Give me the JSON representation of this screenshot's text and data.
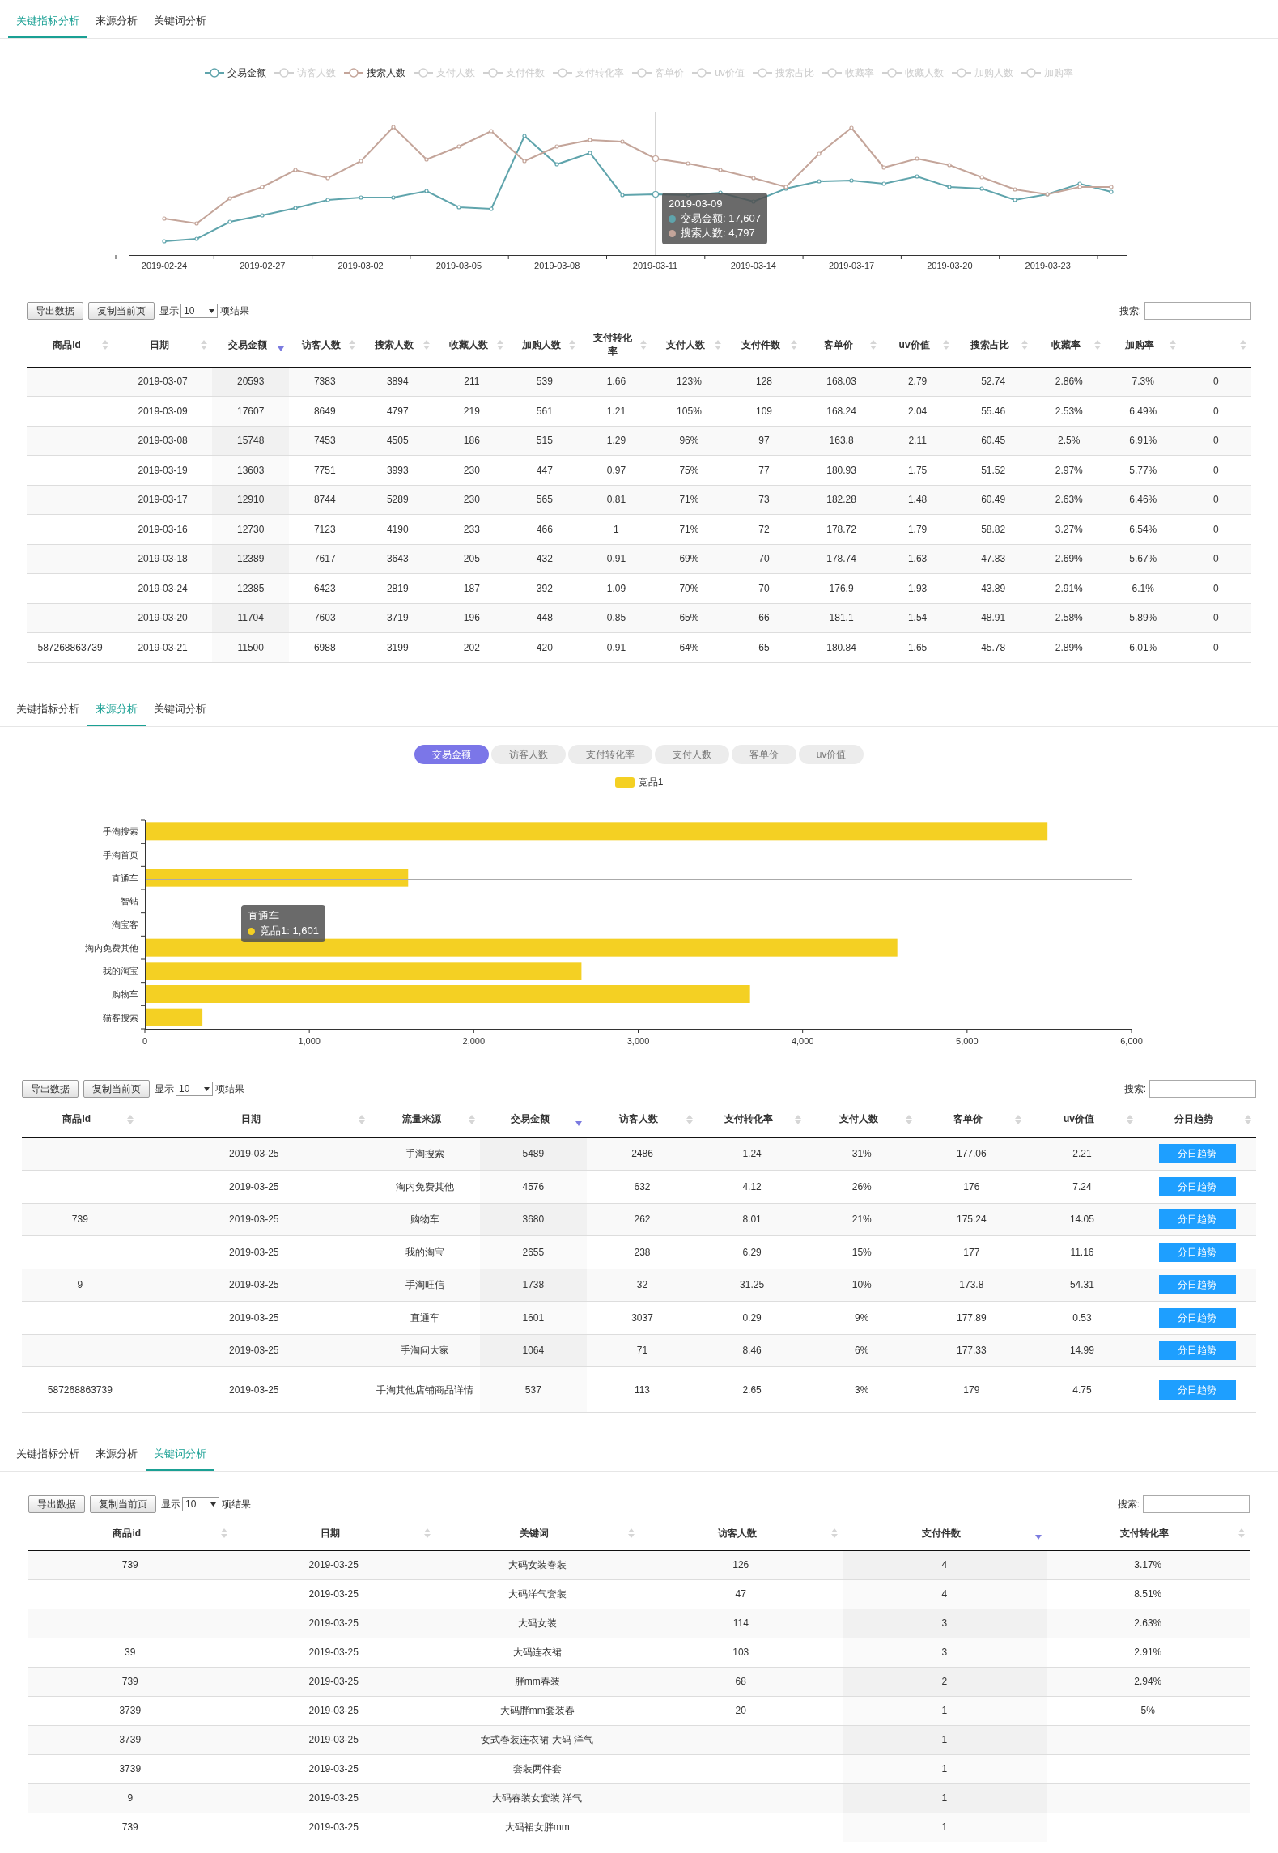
{
  "panels": [
    {
      "kind": "line",
      "tabs": [
        {
          "label": "关键指标分析",
          "selected": true
        },
        {
          "label": "来源分析",
          "selected": false
        },
        {
          "label": "关键词分析",
          "selected": false
        }
      ],
      "legend": [
        {
          "label": "交易金额",
          "selected": true,
          "color": "#5fa4ac"
        },
        {
          "label": "访客人数",
          "selected": false
        },
        {
          "label": "搜索人数",
          "selected": true,
          "color": "#c4a59a"
        },
        {
          "label": "支付人数",
          "selected": false
        },
        {
          "label": "支付件数",
          "selected": false
        },
        {
          "label": "支付转化率",
          "selected": false
        },
        {
          "label": "客单价",
          "selected": false
        },
        {
          "label": "uv价值",
          "selected": false
        },
        {
          "label": "搜索占比",
          "selected": false
        },
        {
          "label": "收藏率",
          "selected": false
        },
        {
          "label": "收藏人数",
          "selected": false
        },
        {
          "label": "加购人数",
          "selected": false
        },
        {
          "label": "加购率",
          "selected": false
        }
      ],
      "x_labels": [
        "2019-02-24",
        "2019-02-27",
        "2019-03-02",
        "2019-03-05",
        "2019-03-08",
        "2019-03-11",
        "2019-03-14",
        "2019-03-17",
        "2019-03-20",
        "2019-03-23"
      ],
      "tooltip": {
        "title": "2019-03-09",
        "items": [
          {
            "text": "交易金额: 17,607",
            "color": "#5fa4ac"
          },
          {
            "text": "搜索人数: 4,797",
            "color": "#c4a59a"
          }
        ]
      },
      "table": {
        "toolbar": {
          "buttons": [
            "导出数据",
            "复制当前页"
          ],
          "show_label": "显示",
          "page_size": "10",
          "suffix": "项结果",
          "search_label": "搜索:"
        },
        "columns": [
          {
            "label": "商品id",
            "sorted": false
          },
          {
            "label": "日期",
            "sorted": false
          },
          {
            "label": "交易金额",
            "sorted": true
          },
          {
            "label": "访客人数",
            "sorted": false
          },
          {
            "label": "搜索人数",
            "sorted": false
          },
          {
            "label": "收藏人数",
            "sorted": false
          },
          {
            "label": "加购人数",
            "sorted": false
          },
          {
            "label": "支付转化率",
            "sorted": false
          },
          {
            "label": "支付人数",
            "sorted": false
          },
          {
            "label": "支付件数",
            "sorted": false
          },
          {
            "label": "客单价",
            "sorted": false
          },
          {
            "label": "uv价值",
            "sorted": false
          },
          {
            "label": "搜索占比",
            "sorted": false
          },
          {
            "label": "收藏率",
            "sorted": false
          },
          {
            "label": "加购率",
            "sorted": false
          },
          {
            "sorted": false
          }
        ],
        "rows": [
          [
            null,
            "2019-03-07",
            "20593",
            "7383",
            "3894",
            "211",
            "539",
            "1.66",
            "123%",
            "128",
            "168.03",
            "2.79",
            "52.74",
            "2.86%",
            "7.3%",
            "0"
          ],
          [
            null,
            "2019-03-09",
            "17607",
            "8649",
            "4797",
            "219",
            "561",
            "1.21",
            "105%",
            "109",
            "168.24",
            "2.04",
            "55.46",
            "2.53%",
            "6.49%",
            "0"
          ],
          [
            null,
            "2019-03-08",
            "15748",
            "7453",
            "4505",
            "186",
            "515",
            "1.29",
            "96%",
            "97",
            "163.8",
            "2.11",
            "60.45",
            "2.5%",
            "6.91%",
            "0"
          ],
          [
            null,
            "2019-03-19",
            "13603",
            "7751",
            "3993",
            "230",
            "447",
            "0.97",
            "75%",
            "77",
            "180.93",
            "1.75",
            "51.52",
            "2.97%",
            "5.77%",
            "0"
          ],
          [
            null,
            "2019-03-17",
            "12910",
            "8744",
            "5289",
            "230",
            "565",
            "0.81",
            "71%",
            "73",
            "182.28",
            "1.48",
            "60.49",
            "2.63%",
            "6.46%",
            "0"
          ],
          [
            null,
            "2019-03-16",
            "12730",
            "7123",
            "4190",
            "233",
            "466",
            "1",
            "71%",
            "72",
            "178.72",
            "1.79",
            "58.82",
            "3.27%",
            "6.54%",
            "0"
          ],
          [
            null,
            "2019-03-18",
            "12389",
            "7617",
            "3643",
            "205",
            "432",
            "0.91",
            "69%",
            "70",
            "178.74",
            "1.63",
            "47.83",
            "2.69%",
            "5.67%",
            "0"
          ],
          [
            null,
            "2019-03-24",
            "12385",
            "6423",
            "2819",
            "187",
            "392",
            "1.09",
            "70%",
            "70",
            "176.9",
            "1.93",
            "43.89",
            "2.91%",
            "6.1%",
            "0"
          ],
          [
            null,
            "2019-03-20",
            "11704",
            "7603",
            "3719",
            "196",
            "448",
            "0.85",
            "65%",
            "66",
            "181.1",
            "1.54",
            "48.91",
            "2.58%",
            "5.89%",
            "0"
          ],
          [
            "587268863739",
            "2019-03-21",
            "11500",
            "6988",
            "3199",
            "202",
            "420",
            "0.91",
            "64%",
            "65",
            "180.84",
            "1.65",
            "45.78",
            "2.89%",
            "6.01%",
            "0"
          ]
        ]
      }
    },
    {
      "kind": "bar",
      "tabs": [
        {
          "label": "关键指标分析",
          "selected": false
        },
        {
          "label": "来源分析",
          "selected": true
        },
        {
          "label": "关键词分析",
          "selected": false
        }
      ],
      "metric_buttons": [
        {
          "label": "交易金额",
          "selected": true
        },
        {
          "label": "访客人数",
          "selected": false
        },
        {
          "label": "支付转化率",
          "selected": false
        },
        {
          "label": "支付人数",
          "selected": false
        },
        {
          "label": "客单价",
          "selected": false
        },
        {
          "label": "uv价值",
          "selected": false
        }
      ],
      "chart_data": {
        "type": "bar",
        "orientation": "horizontal",
        "categories": [
          "手淘搜索",
          "手淘首页",
          "直通车",
          "智钻",
          "淘宝客",
          "淘内免费其他",
          "我的淘宝",
          "购物车",
          "猫客搜索"
        ],
        "series": [
          {
            "name": "竞品1",
            "color": "#f4d023",
            "values": [
              5489,
              null,
              1601,
              null,
              null,
              4576,
              2655,
              3680,
              350
            ]
          }
        ],
        "xlim": [
          0,
          6000
        ],
        "xticks": [
          {
            "value": 0,
            "label": "0"
          },
          {
            "value": 1000,
            "label": "1,000"
          },
          {
            "value": 2000,
            "label": "2,000"
          },
          {
            "value": 3000,
            "label": "3,000"
          },
          {
            "value": 4000,
            "label": "4,000"
          },
          {
            "value": 5000,
            "label": "5,000"
          },
          {
            "value": 6000,
            "label": "6,000"
          }
        ]
      },
      "tooltip": {
        "title": "直通车",
        "items": [
          {
            "text": "竞品1: 1,601",
            "color": "#f4d023"
          }
        ]
      },
      "table": {
        "toolbar": {
          "buttons": [
            "导出数据",
            "复制当前页"
          ],
          "show_label": "显示",
          "page_size": "10",
          "suffix": "项结果",
          "search_label": "搜索:"
        },
        "columns": [
          {
            "label": "商品id",
            "sorted": false
          },
          {
            "label": "日期",
            "sorted": false
          },
          {
            "label": "流量来源",
            "sorted": false
          },
          {
            "label": "交易金额",
            "sorted": true
          },
          {
            "label": "访客人数",
            "sorted": false
          },
          {
            "label": "支付转化率",
            "sorted": false
          },
          {
            "label": "支付人数",
            "sorted": false
          },
          {
            "label": "客单价",
            "sorted": false
          },
          {
            "label": "uv价值",
            "sorted": false
          },
          {
            "label": "分日趋势",
            "sorted": false,
            "kind": "button"
          }
        ],
        "rows": [
          [
            null,
            "2019-03-25",
            "手淘搜索",
            "5489",
            "2486",
            "1.24",
            "31%",
            "177.06",
            "2.21",
            "分日趋势"
          ],
          [
            null,
            "2019-03-25",
            "淘内免费其他",
            "4576",
            "632",
            "4.12",
            "26%",
            "176",
            "7.24",
            "分日趋势"
          ],
          [
            "739",
            "2019-03-25",
            "购物车",
            "3680",
            "262",
            "8.01",
            "21%",
            "175.24",
            "14.05",
            "分日趋势"
          ],
          [
            null,
            "2019-03-25",
            "我的淘宝",
            "2655",
            "238",
            "6.29",
            "15%",
            "177",
            "11.16",
            "分日趋势"
          ],
          [
            "9",
            "2019-03-25",
            "手淘旺信",
            "1738",
            "32",
            "31.25",
            "10%",
            "173.8",
            "54.31",
            "分日趋势"
          ],
          [
            null,
            "2019-03-25",
            "直通车",
            "1601",
            "3037",
            "0.29",
            "9%",
            "177.89",
            "0.53",
            "分日趋势"
          ],
          [
            null,
            "2019-03-25",
            "手淘问大家",
            "1064",
            "71",
            "8.46",
            "6%",
            "177.33",
            "14.99",
            "分日趋势"
          ],
          [
            "587268863739",
            "2019-03-25",
            "手淘其他店铺商品详情",
            "537",
            "113",
            "2.65",
            "3%",
            "179",
            "4.75",
            "分日趋势"
          ]
        ]
      }
    },
    {
      "kind": "plain",
      "tabs": [
        {
          "label": "关键指标分析",
          "selected": false
        },
        {
          "label": "来源分析",
          "selected": false
        },
        {
          "label": "关键词分析",
          "selected": true
        }
      ],
      "table": {
        "toolbar": {
          "buttons": [
            "导出数据",
            "复制当前页"
          ],
          "show_label": "显示",
          "page_size": "10",
          "suffix": "项结果",
          "search_label": "搜索:"
        },
        "columns": [
          {
            "label": "商品id",
            "sorted": false
          },
          {
            "label": "日期",
            "sorted": false
          },
          {
            "label": "关键词",
            "sorted": false
          },
          {
            "label": "访客人数",
            "sorted": false
          },
          {
            "label": "支付件数",
            "sorted": true
          },
          {
            "label": "支付转化率",
            "sorted": false
          }
        ],
        "rows": [
          [
            "739",
            "2019-03-25",
            "大码女装春装",
            "126",
            "4",
            "3.17%"
          ],
          [
            null,
            "2019-03-25",
            "大码洋气套装",
            "47",
            "4",
            "8.51%"
          ],
          [
            null,
            "2019-03-25",
            "大码女装",
            "114",
            "3",
            "2.63%"
          ],
          [
            "39",
            "2019-03-25",
            "大码连衣裙",
            "103",
            "3",
            "2.91%"
          ],
          [
            "739",
            "2019-03-25",
            "胖mm春装",
            "68",
            "2",
            "2.94%"
          ],
          [
            "3739",
            "2019-03-25",
            "大码胖mm套装春",
            "20",
            "1",
            "5%"
          ],
          [
            "3739",
            "2019-03-25",
            "女式春装连衣裙 大码 洋气",
            null,
            "1",
            null
          ],
          [
            "3739",
            "2019-03-25",
            "套装两件套",
            null,
            "1",
            null
          ],
          [
            "9",
            "2019-03-25",
            "大码春装女套装 洋气",
            null,
            "1",
            null
          ],
          [
            "739",
            "2019-03-25",
            "大码裙女胖mm",
            null,
            "1",
            null
          ]
        ]
      }
    }
  ]
}
